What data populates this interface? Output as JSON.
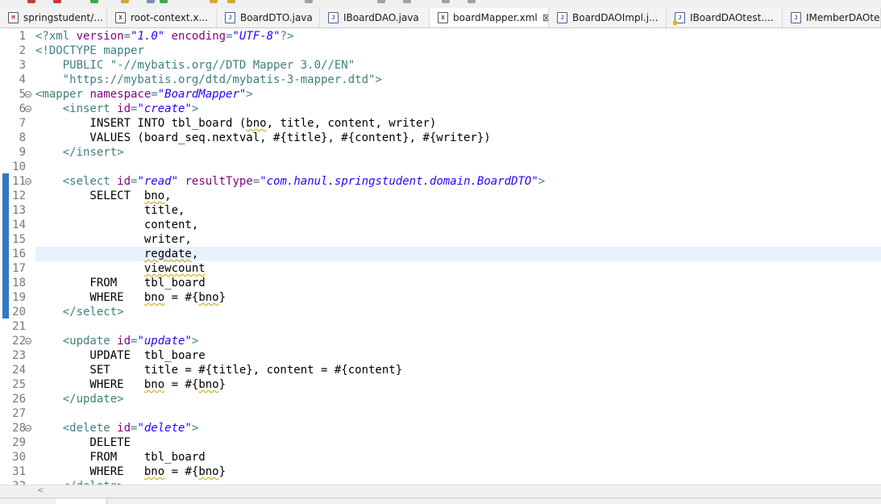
{
  "tabs": [
    {
      "label": "springstudent/...",
      "icon": "mf",
      "glyph": "M",
      "width": 133
    },
    {
      "label": "root-context.x...",
      "icon": "xml",
      "glyph": "X",
      "width": 136
    },
    {
      "label": "BoardDTO.java",
      "icon": "java",
      "glyph": "J",
      "width": 128
    },
    {
      "label": "IBoardDAO.java",
      "icon": "java",
      "glyph": "J",
      "width": 136
    },
    {
      "label": "boardMapper.xml",
      "icon": "xml",
      "glyph": "X",
      "width": 148,
      "active": true,
      "close": "⊠"
    },
    {
      "label": "BoardDAOImpl.j...",
      "icon": "java",
      "glyph": "J",
      "width": 146
    },
    {
      "label": "IBoardDAOtest....",
      "icon": "java warn",
      "glyph": "J",
      "width": 144
    },
    {
      "label": "IMemberDAOtes...",
      "icon": "java",
      "glyph": "J",
      "width": 122
    }
  ],
  "editor": {
    "current_line": 16,
    "lines": [
      {
        "n": "1",
        "parts": [
          [
            "xml",
            "<?xml "
          ],
          [
            "attr",
            "version"
          ],
          [
            "xml",
            "="
          ],
          [
            "val",
            "\"1.0\""
          ],
          [
            "xml",
            " "
          ],
          [
            "attr",
            "encoding"
          ],
          [
            "xml",
            "="
          ],
          [
            "val",
            "\"UTF-8\""
          ],
          [
            "xml",
            "?>"
          ]
        ]
      },
      {
        "n": "2",
        "parts": [
          [
            "doctype",
            "<!DOCTYPE "
          ],
          [
            "doctype",
            "mapper"
          ]
        ]
      },
      {
        "n": "3",
        "parts": [
          [
            "doctype",
            "    PUBLIC "
          ],
          [
            "str",
            "\"-//mybatis.org//DTD Mapper 3.0//EN\""
          ]
        ]
      },
      {
        "n": "4",
        "parts": [
          [
            "str",
            "    \"https://mybatis.org/dtd/mybatis-3-mapper.dtd\""
          ],
          [
            "doctype",
            ">"
          ]
        ]
      },
      {
        "n": "5",
        "fold": true,
        "parts": [
          [
            "tag",
            "<mapper "
          ],
          [
            "attr",
            "namespace"
          ],
          [
            "xml",
            "="
          ],
          [
            "val",
            "\"BoardMapper\""
          ],
          [
            "tag",
            ">"
          ]
        ]
      },
      {
        "n": "6",
        "fold": true,
        "parts": [
          [
            "tag",
            "    <insert "
          ],
          [
            "attr",
            "id"
          ],
          [
            "xml",
            "="
          ],
          [
            "val",
            "\"create\""
          ],
          [
            "tag",
            ">"
          ]
        ]
      },
      {
        "n": "7",
        "parts": [
          [
            "sql",
            "        INSERT INTO tbl_board ("
          ],
          [
            "sqlsq",
            "bno"
          ],
          [
            "sql",
            ", title, content, writer)"
          ]
        ]
      },
      {
        "n": "8",
        "parts": [
          [
            "sql",
            "        VALUES (board_seq.nextval, #{title}, #{content}, #{writer})"
          ]
        ]
      },
      {
        "n": "9",
        "parts": [
          [
            "tag",
            "    </insert>"
          ]
        ]
      },
      {
        "n": "10",
        "parts": []
      },
      {
        "n": "11",
        "fold": true,
        "parts": [
          [
            "tag",
            "    <select "
          ],
          [
            "attr",
            "id"
          ],
          [
            "xml",
            "="
          ],
          [
            "val",
            "\"read\""
          ],
          [
            "xml",
            " "
          ],
          [
            "attr",
            "resultType"
          ],
          [
            "xml",
            "="
          ],
          [
            "val",
            "\"com.hanul.springstudent.domain.BoardDTO\""
          ],
          [
            "tag",
            ">"
          ]
        ]
      },
      {
        "n": "12",
        "parts": [
          [
            "sql",
            "        SELECT  "
          ],
          [
            "sqlsq",
            "bno"
          ],
          [
            "sql",
            ","
          ]
        ]
      },
      {
        "n": "13",
        "parts": [
          [
            "sql",
            "                title,"
          ]
        ]
      },
      {
        "n": "14",
        "parts": [
          [
            "sql",
            "                content,"
          ]
        ]
      },
      {
        "n": "15",
        "parts": [
          [
            "sql",
            "                writer,"
          ]
        ]
      },
      {
        "n": "16",
        "parts": [
          [
            "sql",
            "                "
          ],
          [
            "sqlsq",
            "regdate"
          ],
          [
            "sql",
            ","
          ]
        ]
      },
      {
        "n": "17",
        "parts": [
          [
            "sql",
            "                "
          ],
          [
            "sqlsq",
            "viewcount"
          ]
        ]
      },
      {
        "n": "18",
        "parts": [
          [
            "sql",
            "        FROM    tbl_board"
          ]
        ]
      },
      {
        "n": "19",
        "parts": [
          [
            "sql",
            "        WHERE   "
          ],
          [
            "sqlsq",
            "bno"
          ],
          [
            "sql",
            " = #{"
          ],
          [
            "sqlsq",
            "bno"
          ],
          [
            "sql",
            "}"
          ]
        ]
      },
      {
        "n": "20",
        "parts": [
          [
            "tag",
            "    </select>"
          ]
        ]
      },
      {
        "n": "21",
        "parts": []
      },
      {
        "n": "22",
        "fold": true,
        "parts": [
          [
            "tag",
            "    <update "
          ],
          [
            "attr",
            "id"
          ],
          [
            "xml",
            "="
          ],
          [
            "val",
            "\"update\""
          ],
          [
            "tag",
            ">"
          ]
        ]
      },
      {
        "n": "23",
        "parts": [
          [
            "sql",
            "        UPDATE  tbl_boare"
          ]
        ]
      },
      {
        "n": "24",
        "parts": [
          [
            "sql",
            "        SET     title = #{title}, content = #{content}"
          ]
        ]
      },
      {
        "n": "25",
        "parts": [
          [
            "sql",
            "        WHERE   "
          ],
          [
            "sqlsq",
            "bno"
          ],
          [
            "sql",
            " = #{"
          ],
          [
            "sqlsq",
            "bno"
          ],
          [
            "sql",
            "}"
          ]
        ]
      },
      {
        "n": "26",
        "parts": [
          [
            "tag",
            "    </update>"
          ]
        ]
      },
      {
        "n": "27",
        "parts": []
      },
      {
        "n": "28",
        "fold": true,
        "parts": [
          [
            "tag",
            "    <delete "
          ],
          [
            "attr",
            "id"
          ],
          [
            "xml",
            "="
          ],
          [
            "val",
            "\"delete\""
          ],
          [
            "tag",
            ">"
          ]
        ]
      },
      {
        "n": "29",
        "parts": [
          [
            "sql",
            "        DELETE"
          ]
        ]
      },
      {
        "n": "30",
        "parts": [
          [
            "sql",
            "        FROM    tbl_board"
          ]
        ]
      },
      {
        "n": "31",
        "parts": [
          [
            "sql",
            "        WHERE   "
          ],
          [
            "sqlsq",
            "bno"
          ],
          [
            "sql",
            " = #{"
          ],
          [
            "sqlsq",
            "bno"
          ],
          [
            "sql",
            "}"
          ]
        ]
      },
      {
        "n": "32",
        "parts": [
          [
            "tag",
            "    </delete>"
          ]
        ]
      }
    ]
  },
  "scrollbar": {
    "left_arrow": "<"
  },
  "colors": {
    "accent_marker": "#2f79c6",
    "current_line": "#e8f2fe"
  }
}
